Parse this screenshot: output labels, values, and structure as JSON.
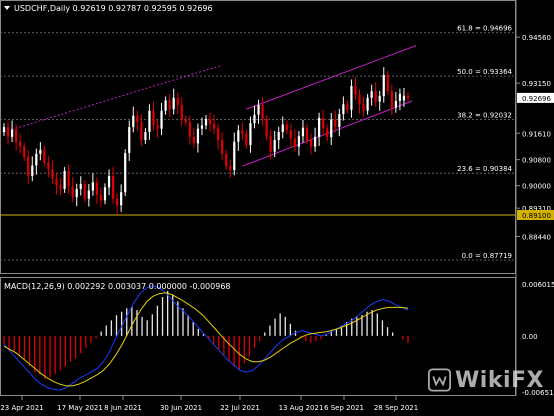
{
  "header": {
    "symbol_line": "USDCHF,Daily  0.92619 0.92787 0.92595 0.92696"
  },
  "colors": {
    "bull": "#ffffff",
    "bear": "#e00000",
    "channel": "#c020c0",
    "support_line": "#d4b000",
    "macd_signal": "#e6d200",
    "macd_line": "#1a3cff",
    "grid": "#7a7a7a",
    "price_tag": "#ffffff"
  },
  "fib_levels": [
    {
      "label": "61.8 = 0.94696",
      "price": 0.94696
    },
    {
      "label": "50.0 = 0.93364",
      "price": 0.93364
    },
    {
      "label": "38.2 = 0.92032",
      "price": 0.92032
    },
    {
      "label": "23.6 = 0.90384",
      "price": 0.90384
    },
    {
      "label": "0.0 = 0.87719",
      "price": 0.87719
    }
  ],
  "price_axis": [
    "0.94560",
    "0.93150",
    "0.91610",
    "0.90800",
    "0.90000",
    "0.89310",
    "0.88440"
  ],
  "current_price": "0.92696",
  "support_price": "0.89100",
  "macd": {
    "title": "MACD(12,26,9) 0.002292 0.003037 0.000000 -0.000968",
    "axis": [
      "0.006015",
      "0.00",
      "-0.00651"
    ]
  },
  "x_axis": [
    "23 Apr 2021",
    "17 May 2021",
    "8 Jun 2021",
    "30 Jun 2021",
    "22 Jul 2021",
    "13 Aug 2021",
    "6 Sep 2021",
    "28 Sep 2021"
  ],
  "chart_data": {
    "type": "candlestick",
    "symbol": "USDCHF",
    "timeframe": "Daily",
    "ohlc_last": {
      "open": 0.92619,
      "high": 0.92787,
      "low": 0.92595,
      "close": 0.92696
    },
    "ylim": [
      0.8735,
      0.9521
    ],
    "closes": [
      0.918,
      0.915,
      0.9172,
      0.9135,
      0.912,
      0.9088,
      0.903,
      0.9062,
      0.9098,
      0.911,
      0.907,
      0.905,
      0.9022,
      0.9001,
      0.899,
      0.9045,
      0.8998,
      0.8965,
      0.899,
      0.9005,
      0.896,
      0.8985,
      0.901,
      0.8972,
      0.8955,
      0.8995,
      0.903,
      0.896,
      0.894,
      0.898,
      0.91,
      0.918,
      0.9215,
      0.9195,
      0.914,
      0.9165,
      0.923,
      0.9185,
      0.9175,
      0.923,
      0.9262,
      0.9235,
      0.927,
      0.9248,
      0.9203,
      0.9195,
      0.915,
      0.913,
      0.9175,
      0.9185,
      0.9205,
      0.919,
      0.9175,
      0.914,
      0.9098,
      0.906,
      0.9048,
      0.9135,
      0.917,
      0.916,
      0.9125,
      0.9192,
      0.9218,
      0.9248,
      0.9205,
      0.9152,
      0.9104,
      0.914,
      0.9165,
      0.9188,
      0.917,
      0.9145,
      0.912,
      0.9152,
      0.9178,
      0.914,
      0.912,
      0.915,
      0.9208,
      0.9176,
      0.9149,
      0.9203,
      0.918,
      0.922,
      0.925,
      0.9233,
      0.9306,
      0.928,
      0.925,
      0.923,
      0.927,
      0.929,
      0.9258,
      0.9275,
      0.934,
      0.929,
      0.924,
      0.926,
      0.9282,
      0.9276,
      0.927
    ],
    "opens": [
      0.9165,
      0.918,
      0.915,
      0.9172,
      0.9135,
      0.912,
      0.9088,
      0.903,
      0.9062,
      0.9098,
      0.911,
      0.907,
      0.905,
      0.9022,
      0.9001,
      0.899,
      0.9045,
      0.8998,
      0.8965,
      0.899,
      0.9005,
      0.896,
      0.8985,
      0.901,
      0.8972,
      0.8955,
      0.8995,
      0.903,
      0.896,
      0.894,
      0.898,
      0.91,
      0.918,
      0.9215,
      0.9195,
      0.914,
      0.9165,
      0.923,
      0.9185,
      0.9175,
      0.923,
      0.9262,
      0.9235,
      0.927,
      0.9248,
      0.9203,
      0.9195,
      0.915,
      0.913,
      0.9175,
      0.9185,
      0.9205,
      0.919,
      0.9175,
      0.914,
      0.9098,
      0.906,
      0.9048,
      0.9135,
      0.917,
      0.916,
      0.9125,
      0.9192,
      0.9218,
      0.9248,
      0.9205,
      0.9152,
      0.9104,
      0.914,
      0.9165,
      0.9188,
      0.917,
      0.9145,
      0.912,
      0.9152,
      0.9178,
      0.914,
      0.912,
      0.915,
      0.9208,
      0.9176,
      0.9149,
      0.9203,
      0.918,
      0.922,
      0.925,
      0.9233,
      0.9306,
      0.928,
      0.925,
      0.923,
      0.927,
      0.929,
      0.9258,
      0.9275,
      0.934,
      0.929,
      0.924,
      0.926,
      0.9262,
      0.9276
    ],
    "macd_hist": [
      -0.001,
      -0.0015,
      -0.0018,
      -0.0022,
      -0.0028,
      -0.0035,
      -0.0042,
      -0.0045,
      -0.005,
      -0.0048,
      -0.0044,
      -0.004,
      -0.0036,
      -0.003,
      -0.0026,
      -0.002,
      -0.0014,
      -0.0008,
      -0.0003,
      0.0005,
      0.0012,
      0.0018,
      0.0024,
      0.0028,
      0.0032,
      0.0034,
      0.003,
      0.0022,
      0.0018,
      0.0025,
      0.0035,
      0.0045,
      0.0052,
      0.0048,
      0.004,
      0.0032,
      0.0024,
      0.0016,
      0.0008,
      0.0002,
      -0.0004,
      -0.001,
      -0.0016,
      -0.0022,
      -0.003,
      -0.0036,
      -0.004,
      -0.0032,
      -0.0024,
      -0.0014,
      -0.0006,
      0.0004,
      0.0012,
      0.002,
      0.0026,
      0.0022,
      0.0014,
      0.0006,
      -0.0002,
      -0.0006,
      -0.0008,
      -0.0006,
      -0.0004,
      0.0002,
      0.0006,
      0.0008,
      0.0012,
      0.0016,
      0.002,
      0.0022,
      0.0024,
      0.0028,
      0.003,
      0.0026,
      0.0018,
      0.001,
      0.0004,
      0.0,
      -0.0004,
      -0.0008
    ],
    "macd_line": [
      -0.001,
      -0.0018,
      -0.0026,
      -0.0034,
      -0.0042,
      -0.005,
      -0.0056,
      -0.006,
      -0.0062,
      -0.0063,
      -0.006,
      -0.0055,
      -0.005,
      -0.0046,
      -0.0042,
      -0.0038,
      -0.003,
      -0.0018,
      -0.0002,
      0.0012,
      0.0026,
      0.004,
      0.005,
      0.0056,
      0.0058,
      0.0056,
      0.005,
      0.0042,
      0.0034,
      0.0028,
      0.002,
      0.0012,
      0.0004,
      -0.0004,
      -0.0012,
      -0.002,
      -0.0028,
      -0.0034,
      -0.004,
      -0.0042,
      -0.004,
      -0.0034,
      -0.0026,
      -0.0018,
      -0.001,
      -0.0004,
      0.0,
      0.0004,
      0.0006,
      0.0004,
      0.0002,
      0.0,
      0.0002,
      0.0006,
      0.001,
      0.0014,
      0.0018,
      0.0024,
      0.003,
      0.0036,
      0.004,
      0.0042,
      0.004,
      0.0036,
      0.0033,
      0.003
    ],
    "macd_signal": [
      -0.0012,
      -0.0016,
      -0.002,
      -0.0026,
      -0.0032,
      -0.0038,
      -0.0044,
      -0.0049,
      -0.0053,
      -0.0056,
      -0.0058,
      -0.0058,
      -0.0056,
      -0.0053,
      -0.0049,
      -0.0045,
      -0.004,
      -0.0032,
      -0.0022,
      -0.001,
      0.0004,
      0.0018,
      0.003,
      0.004,
      0.0046,
      0.0049,
      0.005,
      0.0048,
      0.0044,
      0.004,
      0.0035,
      0.003,
      0.0024,
      0.0016,
      0.0008,
      0.0,
      -0.0008,
      -0.0015,
      -0.0022,
      -0.0027,
      -0.003,
      -0.003,
      -0.0028,
      -0.0024,
      -0.0019,
      -0.0014,
      -0.0009,
      -0.0005,
      -0.0001,
      0.0002,
      0.0003,
      0.0004,
      0.0005,
      0.0007,
      0.0009,
      0.0012,
      0.0015,
      0.0019,
      0.0023,
      0.0027,
      0.003,
      0.0032,
      0.0033,
      0.0033,
      0.0033,
      0.0032
    ]
  }
}
